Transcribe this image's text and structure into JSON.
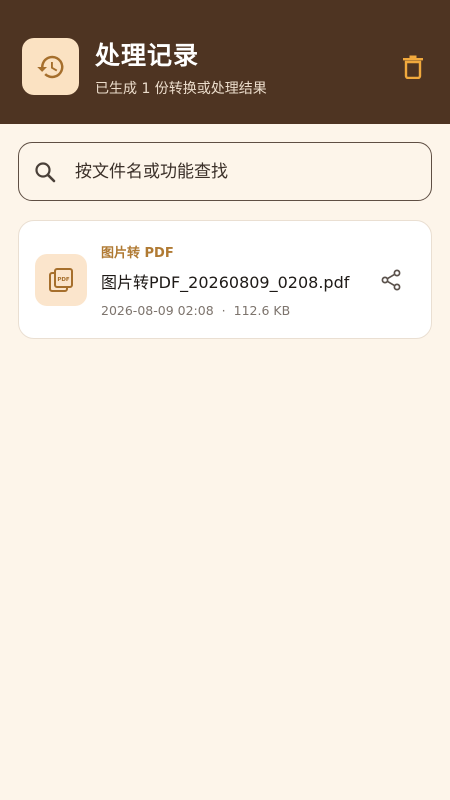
{
  "header": {
    "title": "处理记录",
    "subtitle": "已生成 1 份转换或处理结果",
    "icon": "history-icon",
    "delete_icon": "trash-icon"
  },
  "search": {
    "placeholder": "按文件名或功能查找",
    "value": "",
    "icon": "search-icon"
  },
  "records": [
    {
      "tag": "图片转 PDF",
      "filename": "图片转PDF_20260809_0208.pdf",
      "datetime": "2026-08-09 02:08",
      "separator": "·",
      "size": "112.6 KB",
      "icon": "pdf-file-icon",
      "action_icon": "share-icon"
    }
  ],
  "colors": {
    "header_bg": "#4E3422",
    "page_bg": "#FDF5EA",
    "accent": "#B07A33",
    "icon_bg": "#FBE2C2"
  }
}
